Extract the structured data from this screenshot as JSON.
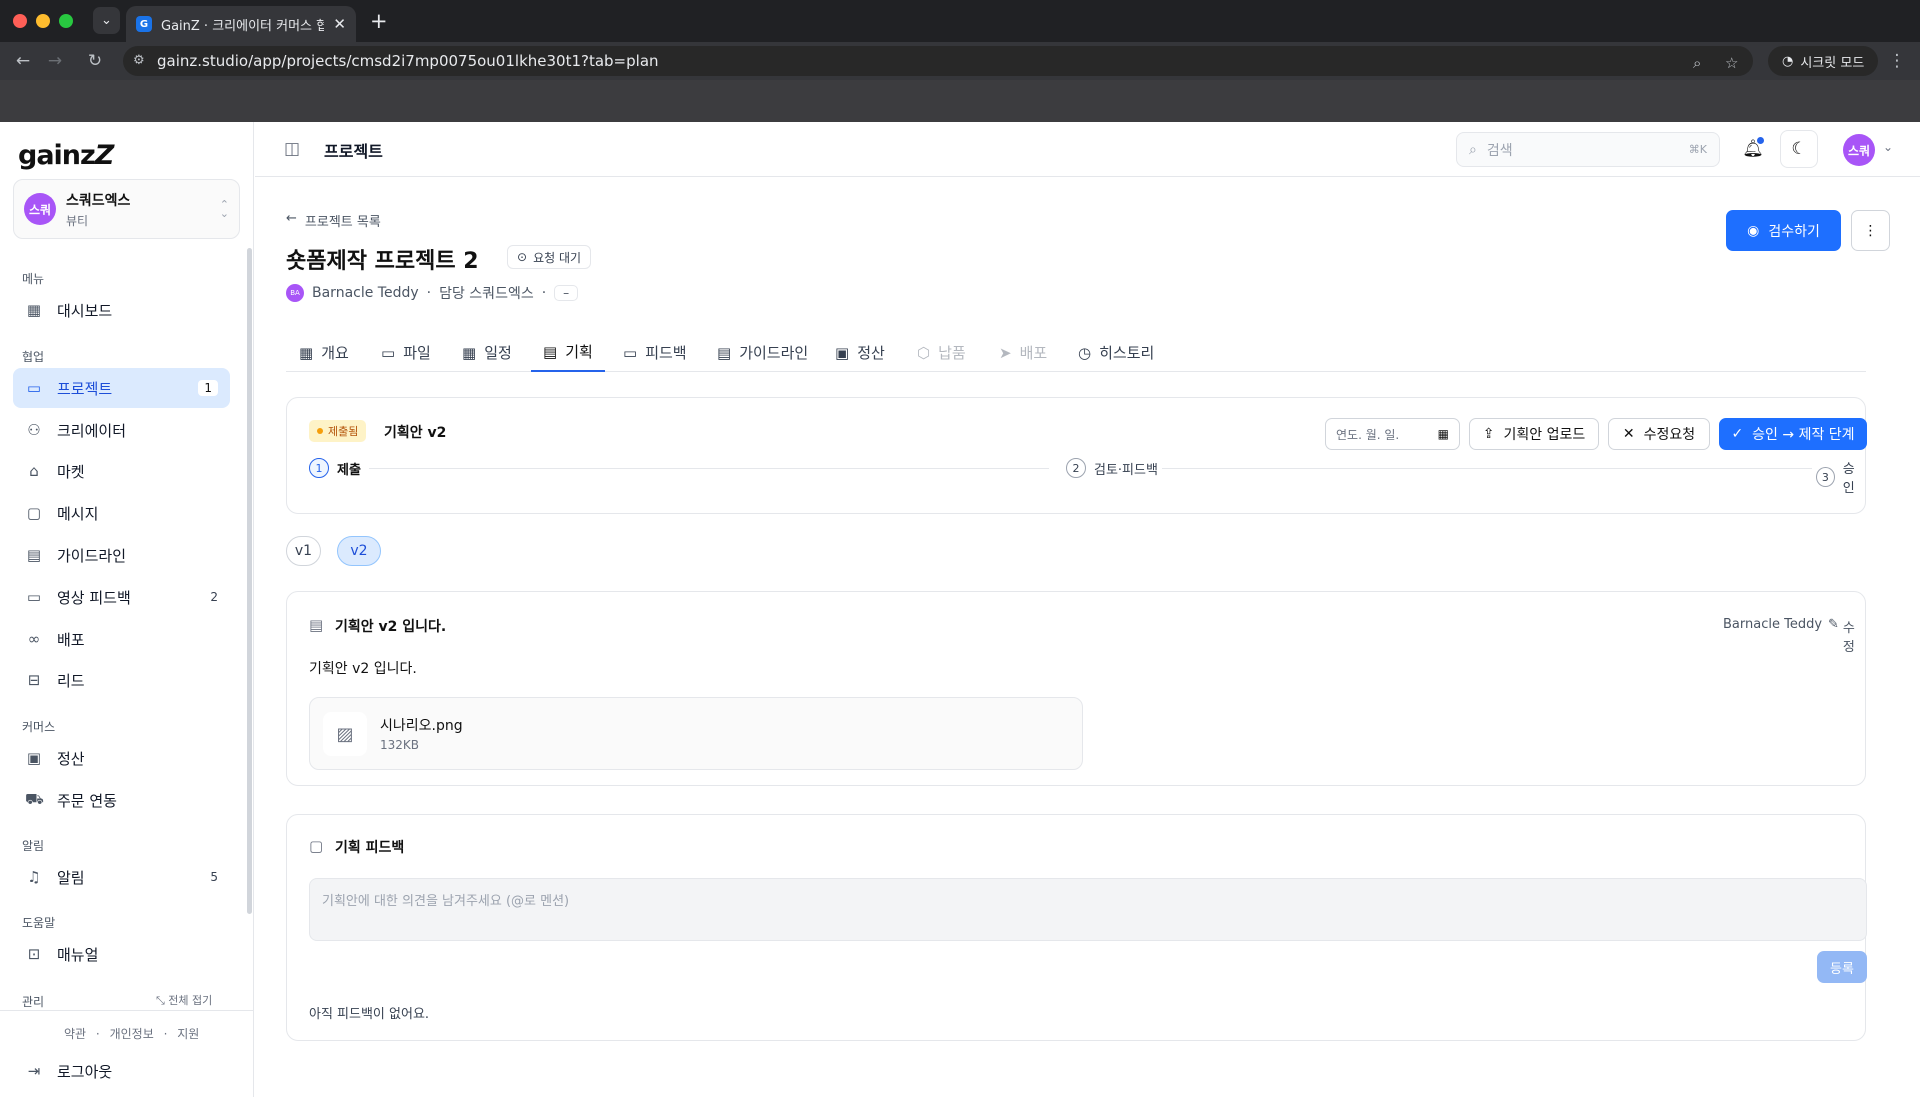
{
  "browser": {
    "tab_title": "GainZ · 크리에이터 커머스 협업 C",
    "favicon": "G",
    "url": "gainz.studio/app/projects/cmsd2i7mp0075ou01lkhe30t1?tab=plan",
    "incognito_label": "시크릿 모드"
  },
  "sidebar": {
    "logo": "gainz",
    "workspace": {
      "avatar": "스쿼",
      "name": "스쿼드엑스",
      "category": "뷰티"
    },
    "sections": {
      "menu": "메뉴",
      "collab": "협업",
      "commerce": "커머스",
      "alert": "알림",
      "help": "도움말",
      "admin": "관리"
    },
    "collapse_all": "전체 접기",
    "items": {
      "dashboard": "대시보드",
      "projects": "프로젝트",
      "projects_badge": "1",
      "creators": "크리에이터",
      "market": "마켓",
      "messages": "메시지",
      "guidelines": "가이드라인",
      "video_feedback": "영상 피드백",
      "video_feedback_badge": "2",
      "distribution": "배포",
      "leads": "리드",
      "settlement": "정산",
      "orders": "주문 연동",
      "notifications": "알림",
      "notifications_badge": "5",
      "manual": "매뉴얼"
    },
    "footer": {
      "terms": "약관",
      "privacy": "개인정보",
      "support": "지원",
      "logout": "로그아웃"
    }
  },
  "topbar": {
    "title": "프로젝트",
    "search_placeholder": "검색",
    "search_shortcut": "⌘K",
    "avatar": "스쿼"
  },
  "project": {
    "back_label": "프로젝트 목록",
    "title": "숏폼제작 프로젝트 2",
    "status": "요청 대기",
    "creator_avatar": "BA",
    "creator": "Barnacle Teddy",
    "manager": "담당 스쿼드엑스",
    "dash": "–",
    "review_button": "검수하기"
  },
  "tabs": [
    {
      "label": "개요",
      "icon": "grid-icon"
    },
    {
      "label": "파일",
      "icon": "folder-icon"
    },
    {
      "label": "일정",
      "icon": "calendar-icon"
    },
    {
      "label": "기획",
      "icon": "clipboard-icon"
    },
    {
      "label": "피드백",
      "icon": "video-icon"
    },
    {
      "label": "가이드라인",
      "icon": "document-icon"
    },
    {
      "label": "정산",
      "icon": "wallet-icon"
    },
    {
      "label": "납품",
      "icon": "box-icon"
    },
    {
      "label": "배포",
      "icon": "send-icon"
    },
    {
      "label": "히스토리",
      "icon": "clock-icon"
    }
  ],
  "plan": {
    "status_badge": "제출됨",
    "version_title": "기획안 v2",
    "date_placeholder": "연도. 월. 일.",
    "upload_button": "기획안 업로드",
    "revision_button": "수정요청",
    "approve_button": "승인 → 제작 단계",
    "steps": [
      {
        "n": "1",
        "label": "제출"
      },
      {
        "n": "2",
        "label": "검토·피드백"
      },
      {
        "n": "3",
        "label": "승인"
      }
    ],
    "versions": [
      "v1",
      "v2"
    ],
    "doc": {
      "heading": "기획안 v2 입니다.",
      "author": "Barnacle Teddy",
      "edit_label": "수정",
      "body": "기획안 v2 입니다.",
      "file_name": "시나리오.png",
      "file_size": "132KB"
    }
  },
  "feedback": {
    "heading": "기획 피드백",
    "placeholder": "기획안에 대한 의견을 남겨주세요 (@로 멘션)",
    "submit": "등록",
    "empty": "아직 피드백이 없어요."
  }
}
